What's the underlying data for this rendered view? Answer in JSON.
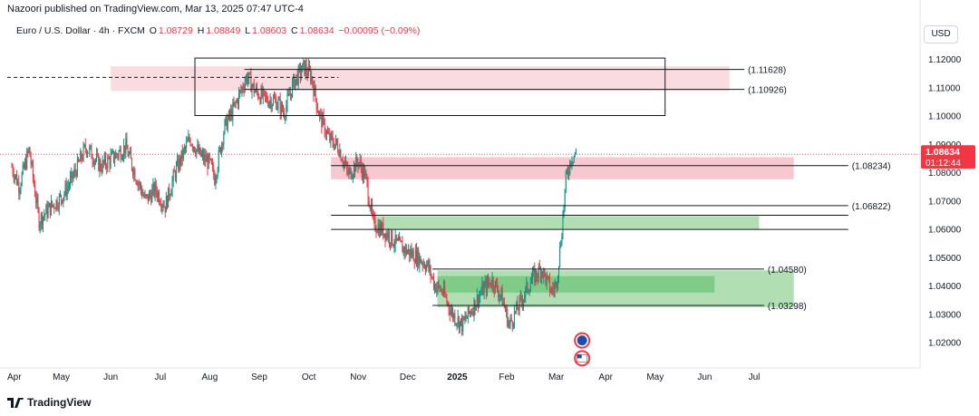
{
  "header": {
    "publisher_line": "Nazoori published on TradingView.com, Mar 13, 2025 07:47 UTC-4"
  },
  "symbol": {
    "name": "Euro / U.S. Dollar · 4h · FXCM",
    "open_label": "O",
    "open": "1.08729",
    "high_label": "H",
    "high": "1.08849",
    "low_label": "L",
    "low": "1.08603",
    "close_label": "C",
    "close": "1.08634",
    "change": "−0.00095 (−0.09%)"
  },
  "currency_button": "USD",
  "last_price": {
    "value": "1.08634",
    "countdown": "01:12:44"
  },
  "footer": {
    "logo_text": "TradingView"
  },
  "colors": {
    "up": "#089981",
    "down": "#f23645",
    "pink_zone": "#f7c5cc",
    "green_zone": "#a8dcab",
    "dark_green_zone": "#7cc986",
    "text": "#131722",
    "grid": "#f0f3fa"
  },
  "chart_data": {
    "type": "candlestick",
    "symbol": "EURUSD",
    "timeframe": "4h",
    "ylim": [
      1.0155,
      1.123
    ],
    "y_ticks": [
      "1.12000",
      "1.11000",
      "1.10000",
      "1.09000",
      "1.08000",
      "1.07000",
      "1.06000",
      "1.05000",
      "1.04000",
      "1.03000",
      "1.02000"
    ],
    "y_tick_values": [
      1.12,
      1.11,
      1.1,
      1.09,
      1.08,
      1.07,
      1.06,
      1.05,
      1.04,
      1.03,
      1.02
    ],
    "x_ticks": [
      {
        "label": "Apr",
        "t": 0
      },
      {
        "label": "May",
        "t": 1
      },
      {
        "label": "Jun",
        "t": 2
      },
      {
        "label": "Jul",
        "t": 3
      },
      {
        "label": "Aug",
        "t": 4
      },
      {
        "label": "Sep",
        "t": 5
      },
      {
        "label": "Oct",
        "t": 6
      },
      {
        "label": "Nov",
        "t": 7
      },
      {
        "label": "Dec",
        "t": 8
      },
      {
        "label": "2025",
        "t": 9
      },
      {
        "label": "Feb",
        "t": 10
      },
      {
        "label": "Mar",
        "t": 11
      },
      {
        "label": "Apr",
        "t": 12
      },
      {
        "label": "May",
        "t": 13
      },
      {
        "label": "Jun",
        "t": 14
      },
      {
        "label": "Jul",
        "t": 15
      }
    ],
    "price_path": [
      [
        0,
        1.082
      ],
      [
        0.15,
        1.075
      ],
      [
        0.35,
        1.088
      ],
      [
        0.55,
        1.063
      ],
      [
        0.8,
        1.068
      ],
      [
        1.0,
        1.071
      ],
      [
        1.2,
        1.077
      ],
      [
        1.5,
        1.089
      ],
      [
        1.8,
        1.082
      ],
      [
        2.1,
        1.086
      ],
      [
        2.3,
        1.089
      ],
      [
        2.5,
        1.079
      ],
      [
        2.7,
        1.07
      ],
      [
        2.9,
        1.074
      ],
      [
        3.1,
        1.068
      ],
      [
        3.3,
        1.08
      ],
      [
        3.6,
        1.092
      ],
      [
        3.8,
        1.086
      ],
      [
        4.0,
        1.083
      ],
      [
        4.1,
        1.078
      ],
      [
        4.3,
        1.096
      ],
      [
        4.5,
        1.103
      ],
      [
        4.75,
        1.114
      ],
      [
        4.9,
        1.109
      ],
      [
        5.1,
        1.106
      ],
      [
        5.35,
        1.105
      ],
      [
        5.5,
        1.101
      ],
      [
        5.7,
        1.112
      ],
      [
        5.9,
        1.117
      ],
      [
        6.05,
        1.114
      ],
      [
        6.2,
        1.101
      ],
      [
        6.4,
        1.092
      ],
      [
        6.6,
        1.089
      ],
      [
        6.8,
        1.079
      ],
      [
        7.0,
        1.084
      ],
      [
        7.15,
        1.078
      ],
      [
        7.3,
        1.062
      ],
      [
        7.6,
        1.058
      ],
      [
        7.75,
        1.055
      ],
      [
        8.0,
        1.052
      ],
      [
        8.2,
        1.05
      ],
      [
        8.4,
        1.047
      ],
      [
        8.55,
        1.04
      ],
      [
        8.7,
        1.038
      ],
      [
        8.9,
        1.03
      ],
      [
        9.1,
        1.026
      ],
      [
        9.3,
        1.032
      ],
      [
        9.5,
        1.038
      ],
      [
        9.7,
        1.042
      ],
      [
        9.9,
        1.036
      ],
      [
        10.05,
        1.026
      ],
      [
        10.25,
        1.033
      ],
      [
        10.5,
        1.042
      ],
      [
        10.7,
        1.046
      ],
      [
        10.9,
        1.038
      ],
      [
        11.0,
        1.04
      ],
      [
        11.1,
        1.057
      ],
      [
        11.2,
        1.078
      ],
      [
        11.3,
        1.085
      ],
      [
        11.4,
        1.087
      ]
    ],
    "zones": [
      {
        "kind": "pink",
        "t0": 2.0,
        "t1": 14.5,
        "y0": 1.1087,
        "y1": 1.1174
      },
      {
        "kind": "pink",
        "t0": 6.45,
        "t1": 15.8,
        "y0": 1.0775,
        "y1": 1.0853
      },
      {
        "kind": "green",
        "t0": 7.3,
        "t1": 15.1,
        "y0": 1.0598,
        "y1": 1.0645
      },
      {
        "kind": "green",
        "t0": 8.6,
        "t1": 15.8,
        "y0": 1.0323,
        "y1": 1.0453
      },
      {
        "kind": "dark_green",
        "t0": 8.6,
        "t1": 14.2,
        "y0": 1.0375,
        "y1": 1.0433
      }
    ],
    "box": {
      "t0": 3.7,
      "t1": 13.2,
      "y0": 1.1,
      "y1": 1.1203
    },
    "levels": [
      {
        "label": "(1.11628)",
        "value": 1.11628,
        "t0": 4.7,
        "t1": 14.8
      },
      {
        "label": "(1.10926)",
        "value": 1.10926,
        "t0": 4.7,
        "t1": 14.8
      },
      {
        "label": "(1.08234)",
        "value": 1.08234,
        "t0": 6.45,
        "t1": 16.9
      },
      {
        "label": "(1.06822)",
        "value": 1.06822,
        "t0": 6.8,
        "t1": 16.9
      },
      {
        "label": "",
        "value": 1.0648,
        "t0": 6.45,
        "t1": 16.9
      },
      {
        "label": "",
        "value": 1.0598,
        "t0": 6.45,
        "t1": 16.9
      },
      {
        "label": "(1.04580)",
        "value": 1.0458,
        "t0": 8.5,
        "t1": 15.2
      },
      {
        "label": "(1.03298)",
        "value": 1.03298,
        "t0": 8.5,
        "t1": 15.2
      }
    ],
    "dashed_level": {
      "value": 1.1135,
      "t0": -0.2,
      "t1": 6.6
    },
    "current_price": 1.08634,
    "event_icons": [
      {
        "name": "eu-flag-icon",
        "t": 11.45,
        "y": 1.0206
      },
      {
        "name": "us-flag-icon",
        "t": 11.45,
        "y": 1.0143
      }
    ]
  }
}
